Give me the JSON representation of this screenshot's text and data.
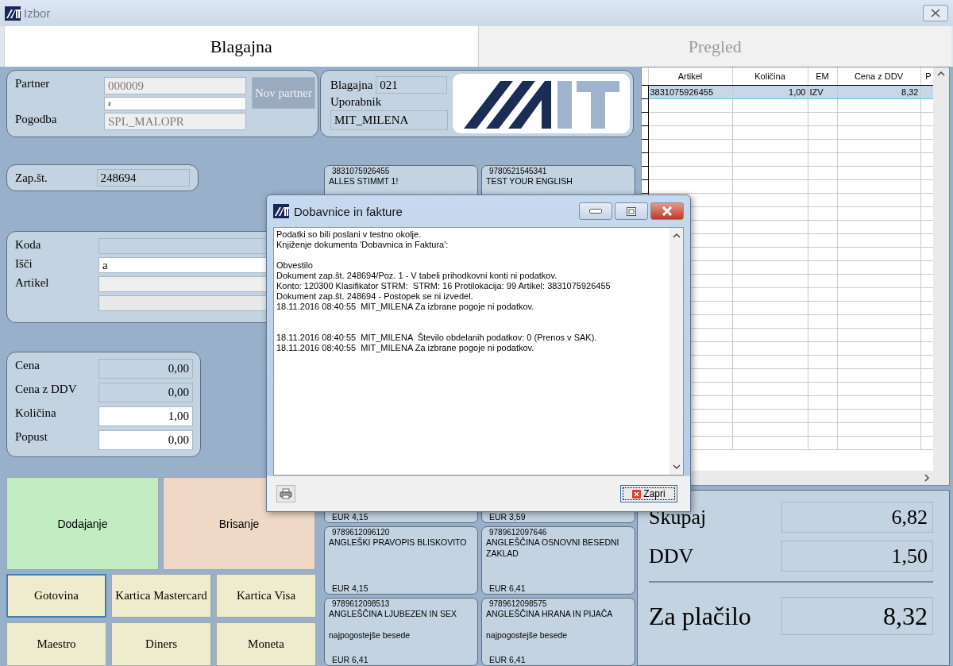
{
  "window": {
    "title": "Izbor"
  },
  "tabs": [
    {
      "label": "Blagajna",
      "selected": true
    },
    {
      "label": "Pregled",
      "selected": false
    }
  ],
  "partner_panel": {
    "fields": [
      {
        "label": "Partner",
        "value": "000009",
        "kind": "disabled"
      },
      {
        "value": "z",
        "kind": "input"
      },
      {
        "label": "Pogodba",
        "value": "SPL_MALOPR",
        "kind": "disabled"
      }
    ],
    "button": "Nov partner"
  },
  "register_panel": {
    "fields": [
      {
        "label": "Blagajna",
        "value": "021",
        "kind": "readonly"
      },
      {
        "label": "Uporabnik",
        "value": "MIT_MILENA",
        "kind": "readonly"
      }
    ]
  },
  "sequence": {
    "label": "Zap.št.",
    "value": "248694",
    "kind": "readonly"
  },
  "search_panel": {
    "fields": [
      {
        "label": "Koda",
        "kind": "readonly"
      },
      {
        "label": "Išči",
        "value": "a",
        "kind": "input"
      },
      {
        "label": "Artikel",
        "kind": "disabled"
      },
      {
        "kind": "blank"
      }
    ]
  },
  "price_panel": {
    "fields": [
      {
        "label": "Cena",
        "value": "0,00",
        "kind": "readonly"
      },
      {
        "label": "Cena z DDV",
        "value": "0,00",
        "kind": "readonly"
      },
      {
        "label": "Količina",
        "value": "1,00",
        "kind": "input"
      },
      {
        "label": "Popust",
        "value": "0,00",
        "kind": "input"
      }
    ]
  },
  "actions": [
    {
      "label": "Dodajanje",
      "color": "#c2ecc2"
    },
    {
      "label": "Brisanje",
      "color": "#efd9c6"
    }
  ],
  "payments": [
    {
      "label": "Gotovina",
      "selected": true
    },
    {
      "label": "Kartica Mastercard",
      "selected": false
    },
    {
      "label": "Kartica Visa",
      "selected": false
    },
    {
      "label": "Maestro",
      "selected": false
    },
    {
      "label": "Diners",
      "selected": false
    },
    {
      "label": "Moneta",
      "selected": false
    }
  ],
  "tiles": [
    {
      "code": "3831075926455",
      "name": "ALLES STIMMT 1!"
    },
    {
      "code": "9780521545341",
      "name": "TEST YOUR ENGLISH"
    },
    {
      "price": "EUR 4,15"
    },
    {
      "price": "EUR 3,59"
    },
    {
      "code": "9789612096120",
      "name": "ANGLEŠKI PRAVOPIS BLISKOVITO",
      "price": "EUR 4,15"
    },
    {
      "code": "9789612097646",
      "name": "ANGLEŠČINA OSNOVNI BESEDNI ZAKLAD",
      "price": "EUR 6,41"
    },
    {
      "code": "9789612098513",
      "name": "ANGLEŠČINA LJUBEZEN IN SEX",
      "note": "najpogostejše besede",
      "price": "EUR 6,41"
    },
    {
      "code": "9789612098575",
      "name": "ANGLEŠČINA HRANA IN PIJAČA",
      "note": "najpogostejše besede",
      "price": "EUR 6,41"
    }
  ],
  "grid": {
    "columns": [
      "Artikel",
      "Količina",
      "EM",
      "Cena z DDV",
      "P"
    ],
    "rows": [
      {
        "cells": [
          "3831075926455",
          "1,00",
          "IZV",
          "8,32"
        ],
        "selected": true
      }
    ]
  },
  "totals": [
    {
      "label": "Skupaj",
      "value": "6,82",
      "kind": "subtotal"
    },
    {
      "label": "DDV",
      "value": "1,50",
      "kind": "subtotal"
    },
    {
      "label": "Za plačilo",
      "value": "8,32",
      "kind": "grand"
    }
  ],
  "dialog": {
    "title": "Dobavnice in fakture",
    "message_groups": [
      [
        "Podatki so bili poslani v testno okolje.",
        "Knjiženje dokumenta 'Dobavnica in Faktura':"
      ],
      [
        "Obvestilo",
        "Dokument zap.št. 248694/Poz. 1 - V tabeli prihodkovni konti ni podatkov.",
        "Konto: 120300 Klasifikator STRM:  STRM: 16 Protilokacija: 99 Artikel: 3831075926455",
        "Dokument zap.št. 248694 - Postopek se ni izvedel.",
        "18.11.2016 08:40:55  MIT_MILENA Za izbrane pogoje ni podatkov."
      ],
      [
        "18.11.2016 08:40:55  MIT_MILENA  Število obdelanih podatkov: 0 (Prenos v SAK).",
        "18.11.2016 08:40:55  MIT_MILENA Za izbrane pogoje ni podatkov."
      ]
    ],
    "close_button": "Zapri"
  }
}
